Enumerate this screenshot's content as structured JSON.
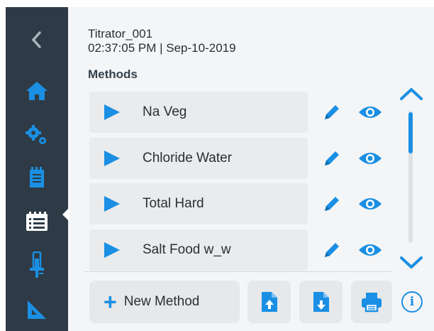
{
  "header": {
    "device_name": "Titrator_001",
    "datetime": "02:37:05 PM | Sep-10-2019"
  },
  "section": {
    "title": "Methods"
  },
  "sidebar": {
    "items": [
      {
        "name": "back",
        "icon": "chevron-left-icon"
      },
      {
        "name": "home",
        "icon": "home-icon"
      },
      {
        "name": "settings",
        "icon": "gears-icon"
      },
      {
        "name": "notes",
        "icon": "notepad-icon"
      },
      {
        "name": "methods",
        "icon": "method-list-icon",
        "active": true
      },
      {
        "name": "electrode",
        "icon": "electrode-icon"
      },
      {
        "name": "calibration",
        "icon": "ruler-triangle-icon"
      }
    ]
  },
  "methods": [
    {
      "label": "Na Veg"
    },
    {
      "label": "Chloride Water"
    },
    {
      "label": "Total Hard"
    },
    {
      "label": "Salt Food w_w"
    }
  ],
  "actions": {
    "new_method_label": "New Method",
    "import_icon": "file-upload-icon",
    "export_icon": "file-download-icon",
    "print_icon": "printer-icon",
    "info_glyph": "i"
  },
  "colors": {
    "accent": "#1a8fe3",
    "sidebar_bg": "#2e3b46",
    "sidebar_icon": "#1a8fe3",
    "row_bg": "#e9ebed",
    "panel_bg": "#f4f5f6"
  }
}
